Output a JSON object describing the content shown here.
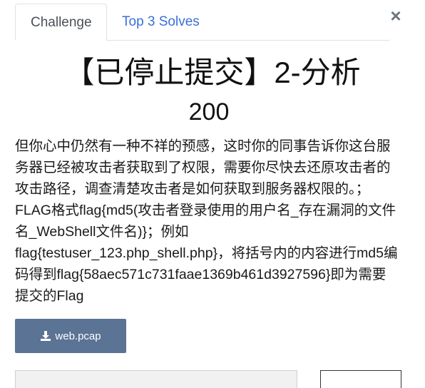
{
  "tabs": [
    {
      "label": "Challenge",
      "active": true
    },
    {
      "label": "Top 3 Solves",
      "active": false
    }
  ],
  "close_glyph": "×",
  "challenge": {
    "title": "【已停止提交】2-分析",
    "points": "200",
    "description_lines": [
      "但你心中仍然有一种不祥的预感，这时你的同事告诉你这台服",
      "务器已经被攻击者获取到了权限，需要你尽快去还原攻击者的",
      "攻击路径，调查清楚攻击者是如何获取到服务器权限的。；",
      "FLAG格式flag{md5(攻击者登录使用的用户名_存在漏洞的文件",
      "名_WebShell文件名)}；例如",
      "flag{testuser_123.php_shell.php}，将括号内的内容进行md5编",
      "码得到flag{58aec571c731faae1369b461d3927596}即为需要",
      "提交的Flag"
    ]
  },
  "file": {
    "label": "web.pcap",
    "icon": "download-icon"
  },
  "colors": {
    "tab_link": "#3a6fd8",
    "file_button": "#5b7394"
  }
}
